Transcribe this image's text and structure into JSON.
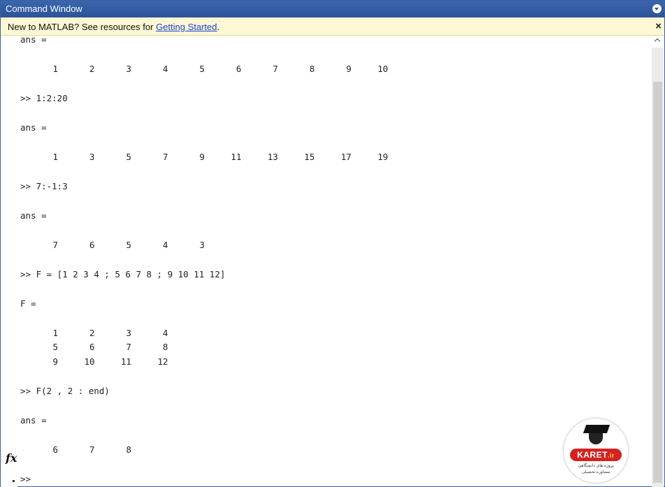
{
  "window": {
    "title": "Command Window"
  },
  "infobar": {
    "message": "New to MATLAB? See resources for ",
    "link": "Getting Started",
    "suffix": "."
  },
  "output": [
    {
      "type": "text",
      "text": "ans ="
    },
    {
      "type": "row",
      "cells": [
        "1",
        "2",
        "3",
        "4",
        "5",
        "6",
        "7",
        "8",
        "9",
        "10"
      ]
    },
    {
      "type": "text",
      "text": ">> 1:2:20"
    },
    {
      "type": "text",
      "text": "ans ="
    },
    {
      "type": "row",
      "cells": [
        "1",
        "3",
        "5",
        "7",
        "9",
        "11",
        "13",
        "15",
        "17",
        "19"
      ]
    },
    {
      "type": "text",
      "text": ">> 7:-1:3"
    },
    {
      "type": "text",
      "text": "ans ="
    },
    {
      "type": "row",
      "cells": [
        "7",
        "6",
        "5",
        "4",
        "3"
      ]
    },
    {
      "type": "text",
      "text": ">> F = [1 2 3 4 ; 5 6 7 8 ; 9 10 11 12]"
    },
    {
      "type": "text",
      "text": "F ="
    },
    {
      "type": "row",
      "cells": [
        "1",
        "2",
        "3",
        "4"
      ]
    },
    {
      "type": "row",
      "cells": [
        "5",
        "6",
        "7",
        "8"
      ]
    },
    {
      "type": "row",
      "cells": [
        "9",
        "10",
        "11",
        "12"
      ]
    },
    {
      "type": "text",
      "text": ">> F(2 , 2 : end)"
    },
    {
      "type": "text",
      "text": "ans ="
    },
    {
      "type": "row",
      "cells": [
        "6",
        "7",
        "8"
      ]
    }
  ],
  "prompt": {
    "fx_label": "fx",
    "prompt_text": ">>"
  },
  "watermark": {
    "brand": "KARET",
    "ext": ".ir",
    "tagline_1": "پروژه های دانشگاهی",
    "tagline_2": "مشاوره تحصیلی"
  }
}
